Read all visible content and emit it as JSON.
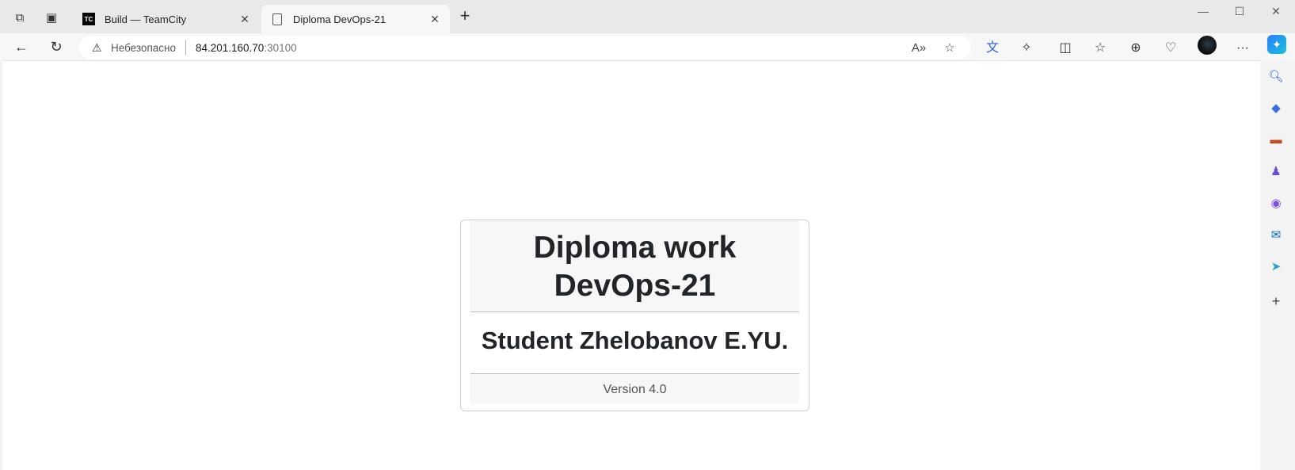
{
  "browser": {
    "tabs": [
      {
        "title": "Build — TeamCity",
        "favicon": "teamcity-icon",
        "favicon_text": "TC"
      },
      {
        "title": "Diploma DevOps-21",
        "favicon": "page-icon"
      }
    ],
    "address": {
      "security_label": "Небезопасно",
      "url_host": "84.201.160.70",
      "url_port": ":30100"
    }
  },
  "page": {
    "title_line1": "Diploma work",
    "title_line2": "DevOps-21",
    "student": "Student Zhelobanov E.YU.",
    "version": "Version 4.0"
  },
  "colors": {
    "card_header_bg": "#f7f7f7",
    "card_border": "#cfcfcf",
    "heading_text": "#212529"
  }
}
